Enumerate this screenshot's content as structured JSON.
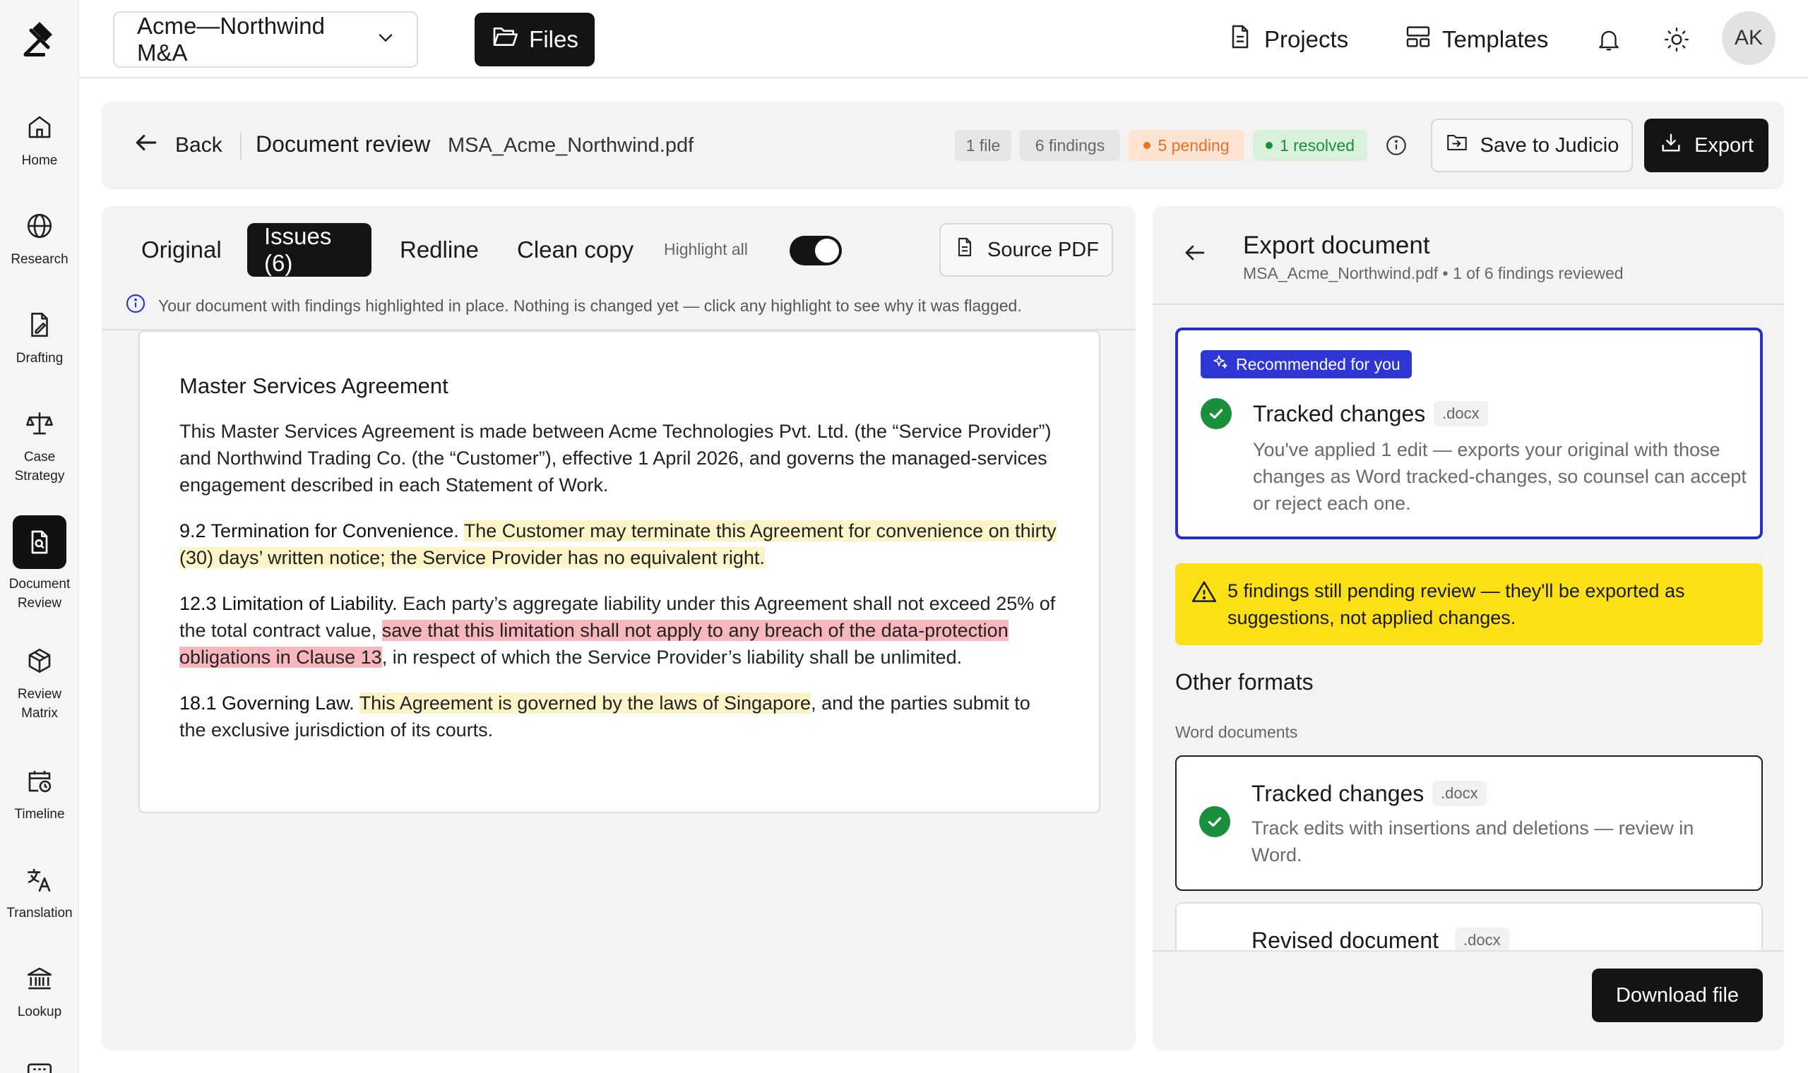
{
  "nav": {
    "items": [
      {
        "label": "Home",
        "icon": "home-icon"
      },
      {
        "label": "Research",
        "icon": "globe-icon"
      },
      {
        "label": "Drafting",
        "icon": "drafting-icon"
      },
      {
        "label": "Case\nStrategy",
        "icon": "scales-icon"
      },
      {
        "label": "Document\nReview",
        "icon": "document-search-icon",
        "active": true
      },
      {
        "label": "Review\nMatrix",
        "icon": "cube-icon"
      },
      {
        "label": "Timeline",
        "icon": "calendar-clock-icon"
      },
      {
        "label": "Translation",
        "icon": "translate-icon"
      },
      {
        "label": "Lookup",
        "icon": "bank-icon"
      }
    ]
  },
  "topbar": {
    "project": "Acme—Northwind M&A",
    "files": "Files",
    "projects": "Projects",
    "templates": "Templates",
    "avatar": "AK"
  },
  "header": {
    "back": "Back",
    "title": "Document review",
    "file": "MSA_Acme_Northwind.pdf",
    "chips": {
      "files": "1 file",
      "findings": "6 findings",
      "pending": "5 pending",
      "resolved": "1 resolved"
    },
    "save": "Save to Judicio",
    "export": "Export"
  },
  "tabs": {
    "original": "Original",
    "issues": "Issues (6)",
    "redline": "Redline",
    "clean": "Clean copy",
    "highlight_all": "Highlight all",
    "source_pdf": "Source PDF"
  },
  "info_line": "Your document with findings highlighted in place. Nothing is changed yet — click any highlight to see why it was flagged.",
  "document": {
    "title": "Master Services Agreement",
    "intro": "This Master Services Agreement is made between Acme Technologies Pvt. Ltd. (the “Service Provider”) and Northwind Trading Co. (the “Customer”), effective 1 April 2026, and governs the managed-services engagement described in each Statement of Work.",
    "c92_head": "9.2 Termination for Convenience.",
    "c92_hl": "The Customer may terminate this Agreement for convenience on thirty (30) days’ written notice; the Service Provider has no equivalent right.",
    "c123_head": "12.3 Limitation of Liability.",
    "c123_pre": "Each party’s aggregate liability under this Agreement shall not exceed 25% of the total contract value,",
    "c123_hl": "save that this limitation shall not apply to any breach of the data-protection obligations in Clause 13",
    "c123_post": ", in respect of which the Service Provider’s liability shall be unlimited.",
    "c181_head": "18.1 Governing Law.",
    "c181_hl": "This Agreement is governed by the laws of Singapore",
    "c181_post": ", and the parties submit to the exclusive jurisdiction of its courts."
  },
  "export_panel": {
    "title": "Export document",
    "subtitle": "MSA_Acme_Northwind.pdf • 1 of 6 findings reviewed",
    "recommended_badge": "Recommended for you",
    "rec_title": "Tracked changes",
    "rec_ext": ".docx",
    "rec_desc": "You've applied 1 edit — exports your original with those changes as Word tracked-changes, so counsel can accept or reject each one.",
    "warning": "5 findings still pending review — they'll be exported as suggestions, not applied changes.",
    "other_formats": "Other formats",
    "word_documents": "Word documents",
    "formats": [
      {
        "title": "Tracked changes",
        "ext": ".docx",
        "desc": "Track edits with insertions and deletions — review in Word."
      },
      {
        "title": "Revised document",
        "ext": ".docx"
      }
    ],
    "download": "Download file"
  },
  "colors": {
    "accent_blue": "#2f36d6",
    "pending_orange": "#e8702a",
    "resolved_green": "#1a8f3c",
    "warning_yellow": "#fbe016",
    "highlight_yellow": "#fcf4c6",
    "highlight_red": "#f7b7bc"
  }
}
